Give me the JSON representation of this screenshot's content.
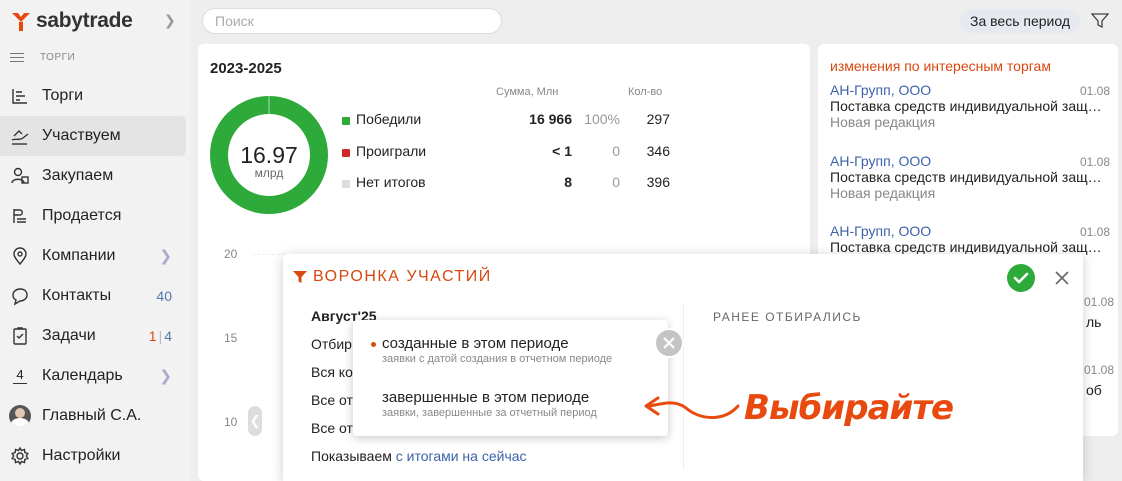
{
  "app": {
    "logo_text": "sabytrade",
    "section": "ТОРГИ"
  },
  "nav": [
    {
      "label": "Торги",
      "icon": "auction-icon"
    },
    {
      "label": "Участвуем",
      "icon": "participate-icon",
      "active": true
    },
    {
      "label": "Закупаем",
      "icon": "purchase-icon"
    },
    {
      "label": "Продается",
      "icon": "sell-icon"
    },
    {
      "label": "Компании",
      "icon": "location-icon",
      "chevron": true
    },
    {
      "label": "Контакты",
      "icon": "chat-icon",
      "badge": "40"
    },
    {
      "label": "Задачи",
      "icon": "tasks-icon",
      "badge_red": "1",
      "badge_blue": "4"
    },
    {
      "label": "Календарь",
      "icon": "calendar-icon",
      "icon_text": "4",
      "chevron": true
    },
    {
      "label": "Главный С.А.",
      "icon": "avatar"
    },
    {
      "label": "Настройки",
      "icon": "gear-icon"
    }
  ],
  "search": {
    "placeholder": "Поиск"
  },
  "period": "За весь период",
  "summary": {
    "years": "2023-2025",
    "donut_value": "16.97",
    "donut_unit": "млрд",
    "col_sum": "Сумма, Млн",
    "col_count": "Кол-во",
    "rows": [
      {
        "label": "Победили",
        "sum": "16 966",
        "pct": "100%",
        "count": "297",
        "color": "#2eaa3a"
      },
      {
        "label": "Проиграли",
        "sum": "< 1",
        "pct": "0",
        "count": "346",
        "color": "#d02828"
      },
      {
        "label": "Нет итогов",
        "sum": "8",
        "pct": "0",
        "count": "396",
        "color": "#dddddd"
      }
    ],
    "axis": [
      "20",
      "15",
      "10"
    ]
  },
  "changes": {
    "title": "изменения по интересным торгам",
    "items": [
      {
        "company": "АН-Групп, ООО",
        "date": "01.08",
        "text": "Поставка средств индивидуальной защиты",
        "status": "Новая редакция"
      },
      {
        "company": "АН-Групп, ООО",
        "date": "01.08",
        "text": "Поставка средств индивидуальной защиты",
        "status": "Новая редакция"
      },
      {
        "company": "АН-Групп, ООО",
        "date": "01.08",
        "text": "Поставка средств индивидуальной защиты"
      }
    ],
    "peek": [
      "01.08",
      "ль",
      "01.08",
      "об"
    ]
  },
  "dialog": {
    "title": "ВОРОНКА УЧАСТИЙ",
    "right_heading": "РАНЕЕ ОТБИРАЛИСЬ",
    "month": "Август'25",
    "lines": [
      "Отбир",
      "Вся ко",
      "Все от",
      "Все от"
    ],
    "showing_prefix": "Показываем",
    "showing_link": "с итогами на сейчас"
  },
  "popup": {
    "options": [
      {
        "title": "созданные в этом периоде",
        "subtitle": "заявки с датой создания в отчетном периоде",
        "selected": true
      },
      {
        "title": "завершенные в этом периоде",
        "subtitle": "заявки, завершенные за отчетный период"
      }
    ]
  },
  "annotation": "Выбирайте",
  "colors": {
    "accent": "#d9480f",
    "green": "#2eaa3a",
    "link": "#3d62a8"
  }
}
